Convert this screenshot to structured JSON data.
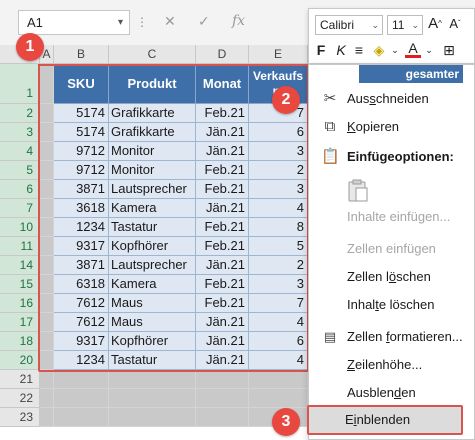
{
  "name_box": "A1",
  "formula_icons": [
    "close-icon",
    "check-icon",
    "fx-icon"
  ],
  "fx_label": "fx",
  "columns": [
    "A",
    "B",
    "C",
    "D",
    "E"
  ],
  "header_row": {
    "sku": "SKU",
    "produkt": "Produkt",
    "monat": "Monat",
    "verkauf": "Verkaufs m"
  },
  "rows": [
    {
      "n": "2",
      "sku": "5174",
      "produkt": "Grafikkarte",
      "monat": "Feb.21",
      "e": "7"
    },
    {
      "n": "3",
      "sku": "5174",
      "produkt": "Grafikkarte",
      "monat": "Jän.21",
      "e": "6"
    },
    {
      "n": "4",
      "sku": "9712",
      "produkt": "Monitor",
      "monat": "Jän.21",
      "e": "3"
    },
    {
      "n": "5",
      "sku": "9712",
      "produkt": "Monitor",
      "monat": "Feb.21",
      "e": "2"
    },
    {
      "n": "6",
      "sku": "3871",
      "produkt": "Lautsprecher",
      "monat": "Feb.21",
      "e": "3"
    },
    {
      "n": "7",
      "sku": "3618",
      "produkt": "Kamera",
      "monat": "Jän.21",
      "e": "4"
    },
    {
      "n": "10",
      "sku": "1234",
      "produkt": "Tastatur",
      "monat": "Feb.21",
      "e": "8"
    },
    {
      "n": "11",
      "sku": "9317",
      "produkt": "Kopfhörer",
      "monat": "Feb.21",
      "e": "5"
    },
    {
      "n": "14",
      "sku": "3871",
      "produkt": "Lautsprecher",
      "monat": "Jän.21",
      "e": "2"
    },
    {
      "n": "15",
      "sku": "6318",
      "produkt": "Kamera",
      "monat": "Feb.21",
      "e": "3"
    },
    {
      "n": "16",
      "sku": "7612",
      "produkt": "Maus",
      "monat": "Feb.21",
      "e": "7"
    },
    {
      "n": "17",
      "sku": "7612",
      "produkt": "Maus",
      "monat": "Jän.21",
      "e": "4"
    },
    {
      "n": "18",
      "sku": "9317",
      "produkt": "Kopfhörer",
      "monat": "Jän.21",
      "e": "6"
    },
    {
      "n": "20",
      "sku": "1234",
      "produkt": "Tastatur",
      "monat": "Jän.21",
      "e": "4"
    }
  ],
  "row_1_label": "1",
  "empty_rows": [
    "21",
    "22",
    "23"
  ],
  "badges": [
    "1",
    "2",
    "3"
  ],
  "minibar": {
    "font": "Calibri",
    "size": "11",
    "grow": "A",
    "shrink": "A",
    "bold": "F",
    "italic": "K",
    "font_color_letter": "A"
  },
  "menu": {
    "header_strip": "gesamter",
    "cut": {
      "pre": "Aus",
      "u": "s",
      "post": "chneiden"
    },
    "copy": {
      "pre": "",
      "u": "K",
      "post": "opieren"
    },
    "paste_options": "Einfügeoptionen:",
    "paste_special": "Inhalte einfügen...",
    "insert_cells": "Zellen einfügen",
    "delete_cells": {
      "pre": "Zellen l",
      "u": "ö",
      "post": "schen"
    },
    "clear_contents": {
      "pre": "Inhal",
      "u": "t",
      "post": "e löschen"
    },
    "format_cells": {
      "pre": "Zellen ",
      "u": "f",
      "post": "ormatieren..."
    },
    "row_height": {
      "pre": "",
      "u": "Z",
      "post": "eilenhöhe..."
    },
    "hide": {
      "pre": "Ausblen",
      "u": "d",
      "post": "en"
    },
    "unhide": {
      "pre": "E",
      "u": "i",
      "post": "nblenden"
    }
  },
  "colors": {
    "header_blue": "#3f6fa8",
    "data_fill": "#dfe7f3",
    "excel_green": "#217346",
    "highlight_red": "#e8483f"
  }
}
